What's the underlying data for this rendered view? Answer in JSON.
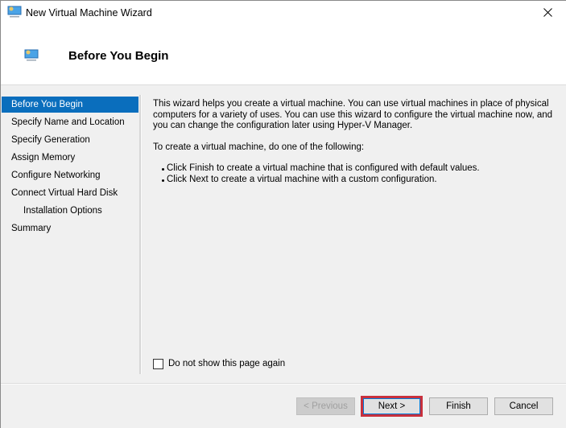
{
  "window": {
    "title": "New Virtual Machine Wizard",
    "title_icon": "virtual-machine-monitor-icon",
    "close_icon": "close-icon"
  },
  "header": {
    "title": "Before You Begin",
    "icon": "virtual-machine-monitor-icon"
  },
  "sidebar": {
    "items": [
      {
        "label": "Before You Begin",
        "active": true
      },
      {
        "label": "Specify Name and Location",
        "active": false
      },
      {
        "label": "Specify Generation",
        "active": false
      },
      {
        "label": "Assign Memory",
        "active": false
      },
      {
        "label": "Configure Networking",
        "active": false
      },
      {
        "label": "Connect Virtual Hard Disk",
        "active": false
      },
      {
        "label": "Installation Options",
        "active": false,
        "indented": true
      },
      {
        "label": "Summary",
        "active": false
      }
    ]
  },
  "content": {
    "intro": "This wizard helps you create a virtual machine. You can use virtual machines in place of physical computers for a variety of uses. You can use this wizard to configure the virtual machine now, and you can change the configuration later using Hyper-V Manager.",
    "instruction": "To create a virtual machine, do one of the following:",
    "bullets": [
      "Click Finish to create a virtual machine that is configured with default values.",
      "Click Next to create a virtual machine with a custom configuration."
    ]
  },
  "checkbox": {
    "label": "Do not show this page again",
    "checked": false
  },
  "buttons": {
    "previous": "< Previous",
    "next": "Next >",
    "finish": "Finish",
    "cancel": "Cancel"
  },
  "colors": {
    "selection": "#0a6ebd",
    "highlight_border": "#c8303c"
  }
}
